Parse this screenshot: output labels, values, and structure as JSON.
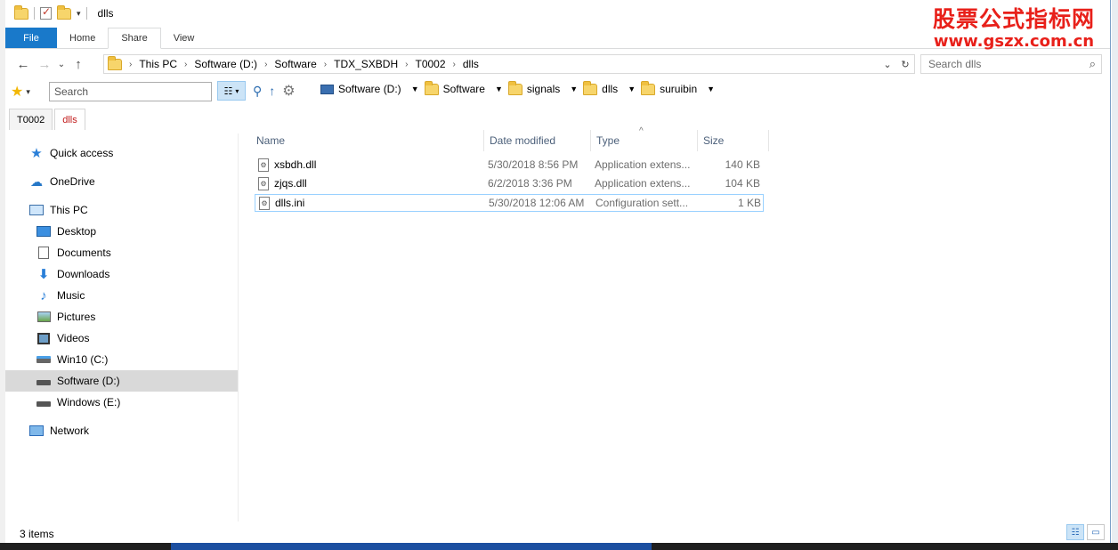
{
  "window": {
    "title": "dlls"
  },
  "watermark": {
    "line1": "股票公式指标网",
    "line2": "www.gszx.com.cn"
  },
  "ribbon": {
    "tabs": [
      "File",
      "Home",
      "Share",
      "View"
    ]
  },
  "address": {
    "crumbs": [
      "This PC",
      "Software (D:)",
      "Software",
      "TDX_SXBDH",
      "T0002",
      "dlls"
    ]
  },
  "search": {
    "placeholder": "Search dlls"
  },
  "toolbar2": {
    "search_placeholder": "Search",
    "quicklinks": [
      "Software (D:)",
      "Software",
      "signals",
      "dlls",
      "suruibin"
    ]
  },
  "tabs": [
    "T0002",
    "dlls"
  ],
  "nav": {
    "items": [
      {
        "label": "Quick access",
        "icon": "quick-access-icon"
      },
      {
        "label": "OneDrive",
        "icon": "onedrive-icon"
      },
      {
        "label": "This PC",
        "icon": "this-pc-icon"
      },
      {
        "label": "Desktop",
        "icon": "desktop-icon"
      },
      {
        "label": "Documents",
        "icon": "documents-icon"
      },
      {
        "label": "Downloads",
        "icon": "downloads-icon"
      },
      {
        "label": "Music",
        "icon": "music-icon"
      },
      {
        "label": "Pictures",
        "icon": "pictures-icon"
      },
      {
        "label": "Videos",
        "icon": "videos-icon"
      },
      {
        "label": "Win10 (C:)",
        "icon": "windows-drive-icon"
      },
      {
        "label": "Software (D:)",
        "icon": "drive-icon"
      },
      {
        "label": "Windows (E:)",
        "icon": "drive-icon"
      },
      {
        "label": "Network",
        "icon": "network-icon"
      }
    ],
    "selected": "Software (D:)"
  },
  "columns": {
    "name": "Name",
    "date": "Date modified",
    "type": "Type",
    "size": "Size"
  },
  "files": [
    {
      "name": "xsbdh.dll",
      "date": "5/30/2018 8:56 PM",
      "type": "Application extens...",
      "size": "140 KB"
    },
    {
      "name": "zjqs.dll",
      "date": "6/2/2018 3:36 PM",
      "type": "Application extens...",
      "size": "104 KB"
    },
    {
      "name": "dlls.ini",
      "date": "5/30/2018 12:06 AM",
      "type": "Configuration sett...",
      "size": "1 KB"
    }
  ],
  "status": {
    "items": "3 items"
  }
}
